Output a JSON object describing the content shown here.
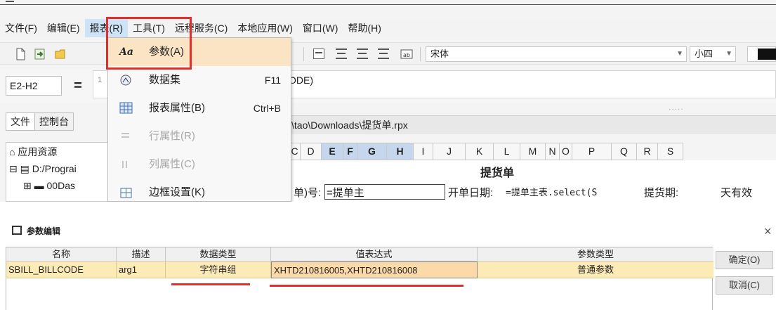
{
  "menubar": {
    "items": [
      "文件(F)",
      "编辑(E)",
      "报表(R)",
      "工具(T)",
      "远程服务(C)",
      "本地应用(W)",
      "窗口(W)",
      "帮助(H)"
    ]
  },
  "toolbar": {
    "font_family": "宋体",
    "font_size": "小四"
  },
  "formula_bar": {
    "cell_ref": "E2-H2",
    "equals": "=",
    "line_number": "1",
    "formula_text": "ODE)"
  },
  "left_panel": {
    "tabs": [
      "文件",
      "控制台"
    ],
    "tree": [
      "应用资源",
      "D:/Prograi",
      "00Das"
    ]
  },
  "document": {
    "tab_path": "\\tao\\Downloads\\提货单.rpx",
    "columns": [
      "C",
      "D",
      "E",
      "F",
      "G",
      "H",
      "I",
      "J",
      "K",
      "L",
      "M",
      "N",
      "O",
      "P",
      "Q",
      "R",
      "S"
    ],
    "sheet_title": "提货单",
    "row2": {
      "cell1": "单)号:",
      "cell1_box": "=提单主",
      "cell2": "开单日期:",
      "cell2_box": "=提单主表.select(S",
      "cell3": "提货期:",
      "cell4": "天有效"
    }
  },
  "report_menu": {
    "items": [
      {
        "label": "参数(A)",
        "shortcut": "",
        "icon": "param-icon",
        "enabled": true,
        "highlighted": true
      },
      {
        "label": "数据集",
        "shortcut": "F11",
        "icon": "dataset-icon",
        "enabled": true,
        "highlighted": false
      },
      {
        "label": "报表属性(B)",
        "shortcut": "Ctrl+B",
        "icon": "report-props-icon",
        "enabled": true,
        "highlighted": false
      },
      {
        "label": "行属性(R)",
        "shortcut": "",
        "icon": "row-props-icon",
        "enabled": false,
        "highlighted": false
      },
      {
        "label": "列属性(C)",
        "shortcut": "",
        "icon": "col-props-icon",
        "enabled": false,
        "highlighted": false
      },
      {
        "label": "边框设置(K)",
        "shortcut": "",
        "icon": "border-icon",
        "enabled": true,
        "highlighted": false
      }
    ]
  },
  "param_dialog": {
    "title": "参数编辑",
    "close": "×",
    "headers": [
      "名称",
      "描述",
      "数据类型",
      "值表达式",
      "参数类型"
    ],
    "rows": [
      {
        "name": "SBILL_BILLCODE",
        "desc": "arg1",
        "data_type": "字符串组",
        "value_expr": "XHTD210816005,XHTD210816008",
        "param_type": "普通参数"
      }
    ],
    "ok_button": "确定(O)",
    "cancel_button": "取消(C)"
  },
  "colors": {
    "highlight_red": "#e0302c",
    "menu_highlight": "#fbe4c4",
    "row_fill": "#fdebb7",
    "selected_column": "#c6d6ec"
  }
}
